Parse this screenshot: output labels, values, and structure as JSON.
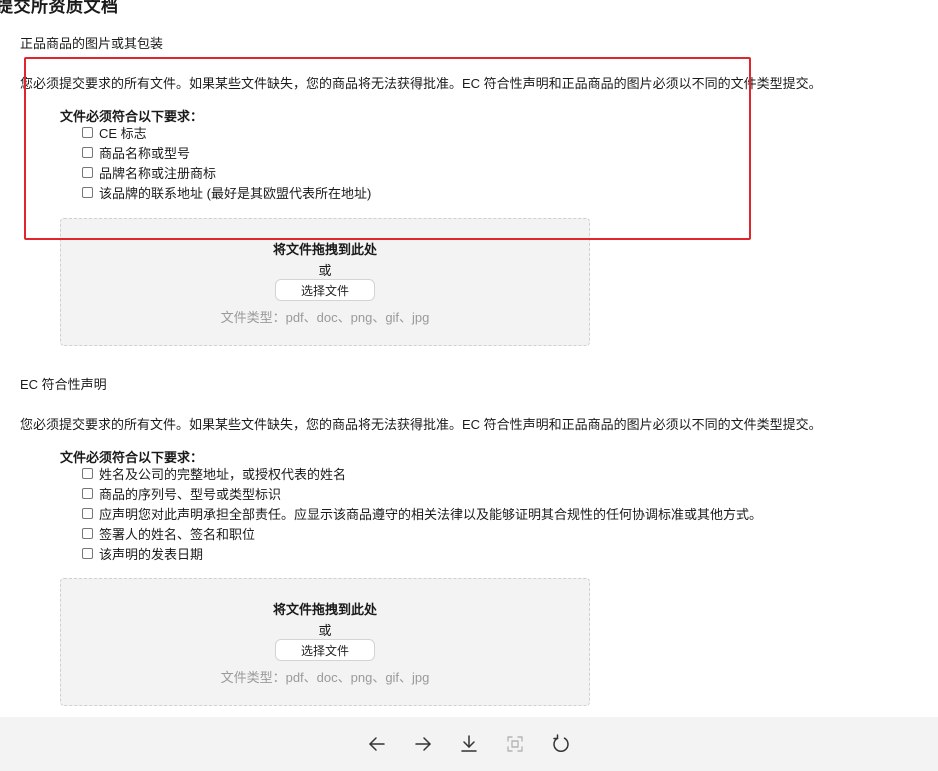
{
  "page_title": "提交所资质文档",
  "sections": [
    {
      "title": "正品商品的图片或其包装",
      "notice": "您必须提交要求的所有文件。如果某些文件缺失，您的商品将无法获得批准。EC 符合性声明和正品商品的图片必须以不同的文件类型提交。",
      "req_heading": "文件必须符合以下要求：",
      "requirements": [
        "CE 标志",
        "商品名称或型号",
        "品牌名称或注册商标",
        "该品牌的联系地址 (最好是其欧盟代表所在地址)"
      ],
      "dropzone": {
        "title": "将文件拖拽到此处",
        "or": "或",
        "button": "选择文件",
        "types": "文件类型：pdf、doc、png、gif、jpg"
      }
    },
    {
      "title": "EC 符合性声明",
      "notice": "您必须提交要求的所有文件。如果某些文件缺失，您的商品将无法获得批准。EC 符合性声明和正品商品的图片必须以不同的文件类型提交。",
      "req_heading": "文件必须符合以下要求：",
      "requirements": [
        "姓名及公司的完整地址，或授权代表的姓名",
        "商品的序列号、型号或类型标识",
        "应声明您对此声明承担全部责任。应显示该商品遵守的相关法律以及能够证明其合规性的任何协调标准或其他方式。",
        "签署人的姓名、签名和职位",
        "该声明的发表日期"
      ],
      "dropzone": {
        "title": "将文件拖拽到此处",
        "or": "或",
        "button": "选择文件",
        "types": "文件类型：pdf、doc、png、gif、jpg"
      }
    }
  ],
  "toolbar": {
    "icons": [
      "arrow-left-icon",
      "arrow-right-icon",
      "download-icon",
      "fit-screen-icon",
      "refresh-icon"
    ]
  },
  "colors": {
    "highlight": "#e0262d",
    "dropzone_bg": "#f3f3f3",
    "toolbar_bg": "#f3f3f3"
  }
}
